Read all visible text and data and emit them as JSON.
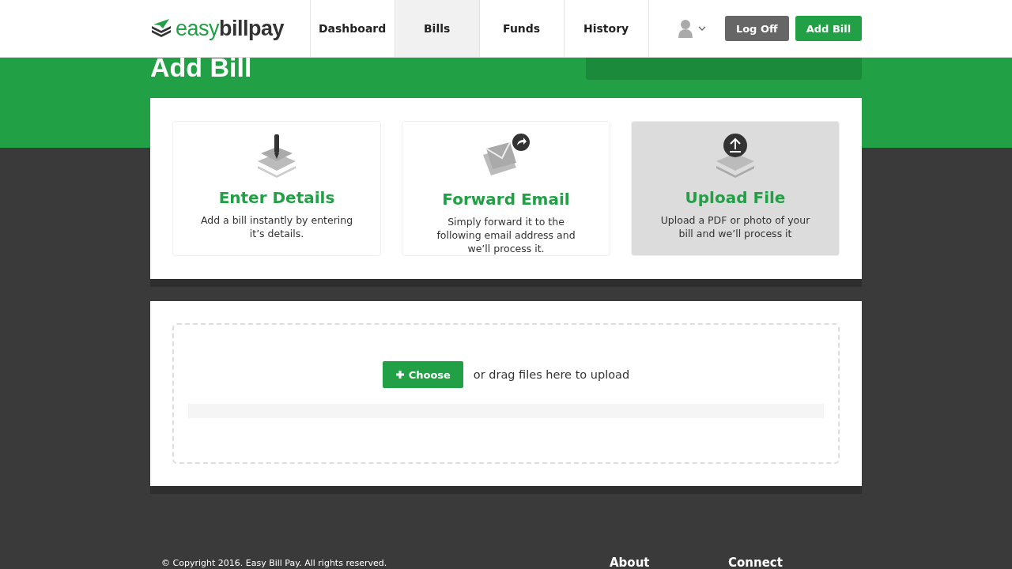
{
  "header": {
    "logo": {
      "light": "easy",
      "bold": "billpay"
    },
    "nav": [
      {
        "label": "Dashboard",
        "selected": false
      },
      {
        "label": "Bills",
        "selected": true
      },
      {
        "label": "Funds",
        "selected": false
      },
      {
        "label": "History",
        "selected": false
      }
    ],
    "buttons": [
      {
        "label": "Log Off",
        "kind": "secondary"
      },
      {
        "label": "Add Bill",
        "kind": "primary"
      }
    ]
  },
  "page_title": "Add Bill",
  "methods": [
    {
      "kind": "enter",
      "title": "Enter Details",
      "description": "Add a bill instantly by entering it’s details.",
      "selected": false
    },
    {
      "kind": "email",
      "title": "Forward Email",
      "description": "Simply forward it to the following email address and we’ll process it.",
      "selected": false
    },
    {
      "kind": "upload",
      "title": "Upload File",
      "description": "Upload a PDF or photo of your bill and we’ll process it",
      "selected": true
    }
  ],
  "upload": {
    "button": "Choose",
    "hint": "or drag files here to upload"
  },
  "footer": {
    "copyright": "© Copyright 2016. Easy Bill Pay. All rights reserved.",
    "headings": [
      "About",
      "Connect"
    ]
  }
}
